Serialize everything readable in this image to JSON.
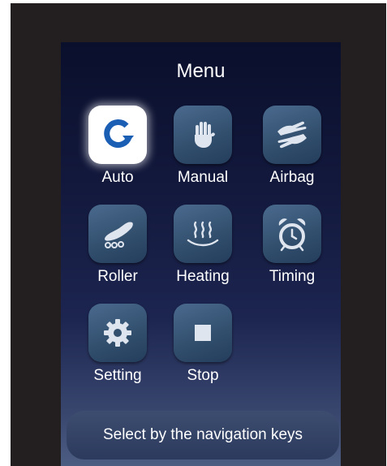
{
  "menu": {
    "title": "Menu",
    "hint": "Select by the navigation keys",
    "items": [
      {
        "label": "Auto",
        "icon": "auto-refresh-icon",
        "selected": true
      },
      {
        "label": "Manual",
        "icon": "hand-icon",
        "selected": false
      },
      {
        "label": "Airbag",
        "icon": "airbag-hands-icon",
        "selected": false
      },
      {
        "label": "Roller",
        "icon": "foot-roller-icon",
        "selected": false
      },
      {
        "label": "Heating",
        "icon": "heat-waves-icon",
        "selected": false
      },
      {
        "label": "Timing",
        "icon": "alarm-clock-icon",
        "selected": false
      },
      {
        "label": "Setting",
        "icon": "gear-icon",
        "selected": false
      },
      {
        "label": "Stop",
        "icon": "stop-square-icon",
        "selected": false
      }
    ]
  },
  "colors": {
    "screen_top": "#0a0f2c",
    "screen_bottom": "#4c5d82",
    "tile": "#3a5777",
    "icon_glyph": "#dfe5ee",
    "selected_tile": "#ffffff",
    "selected_glyph": "#1b5fb5",
    "bezel": "#231f20"
  }
}
